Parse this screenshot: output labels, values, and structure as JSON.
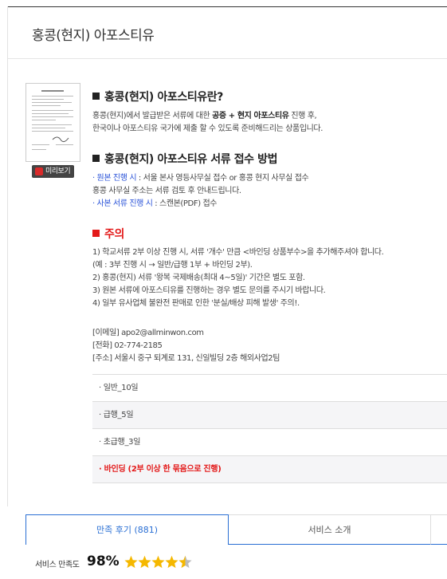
{
  "page": {
    "title": "홍콩(현지) 아포스티유",
    "preview_label": "미리보기"
  },
  "section1": {
    "heading": "홍콩(현지) 아포스티유란?",
    "line1_pre": "홍콩(현지)에서 발급받은 서류에 대한 ",
    "line1_bold": "공증 + 현지 아포스티유",
    "line1_post": " 진행 후,",
    "line2": "한국이나 아포스티유 국가에 제출 할 수 있도록 준비해드리는 상품입니다."
  },
  "section2": {
    "heading": "홍콩(현지) 아포스티유 서류 접수 방법",
    "line1_link": "· 원본 진행 시",
    "line1_text": " : 서울 본사 영등사무실 접수 or 홍콩 현지 사무실 접수",
    "line2": "홍콩 사무실 주소는 서류 검토 후 안내드립니다.",
    "line3_link": "· 사본 서류 진행 시",
    "line3_text": " : 스캔본(PDF) 접수"
  },
  "notice": {
    "heading": "주의",
    "lines": [
      "1) 학교서류 2부 이상 진행 시, 서류 '개수' 만큼 <바인딩 상품부수>을 추가해주셔야 합니다.",
      "(예 : 3부 진행 시 → 일반/급행 1부 + 바인딩 2부).",
      "2) 홍콩(현지) 서류 '왕복 국제배송(최대 4~5일)' 기간은 별도 포함.",
      "3) 원본 서류에 아포스티유를 진행하는 경우 별도 문의를 주시기 바랍니다.",
      "4) 일부 유사업체 불완전 판매로 인한 '분실/배상 피해 발생' 주의!."
    ]
  },
  "contact": {
    "email": "[이메일] apo2@allminwon.com",
    "phone": "[전화] 02-774-2185",
    "address": "[주소] 서울시 중구 퇴계로 131, 신일빌딩 2층 해외사업2팀"
  },
  "options": [
    "· 일반_10일",
    "· 급행_5일",
    "· 초급행_3일",
    "· 바인딩 (2부 이상 한 묶음으로 진행)"
  ],
  "tabs": {
    "reviews": "만족 후기 (881)",
    "service": "서비스 소개"
  },
  "satisfaction": {
    "label": "서비스 만족도",
    "value": "98%",
    "rating": 4.5,
    "max_stars": 5,
    "star_color": "#f5b800"
  }
}
